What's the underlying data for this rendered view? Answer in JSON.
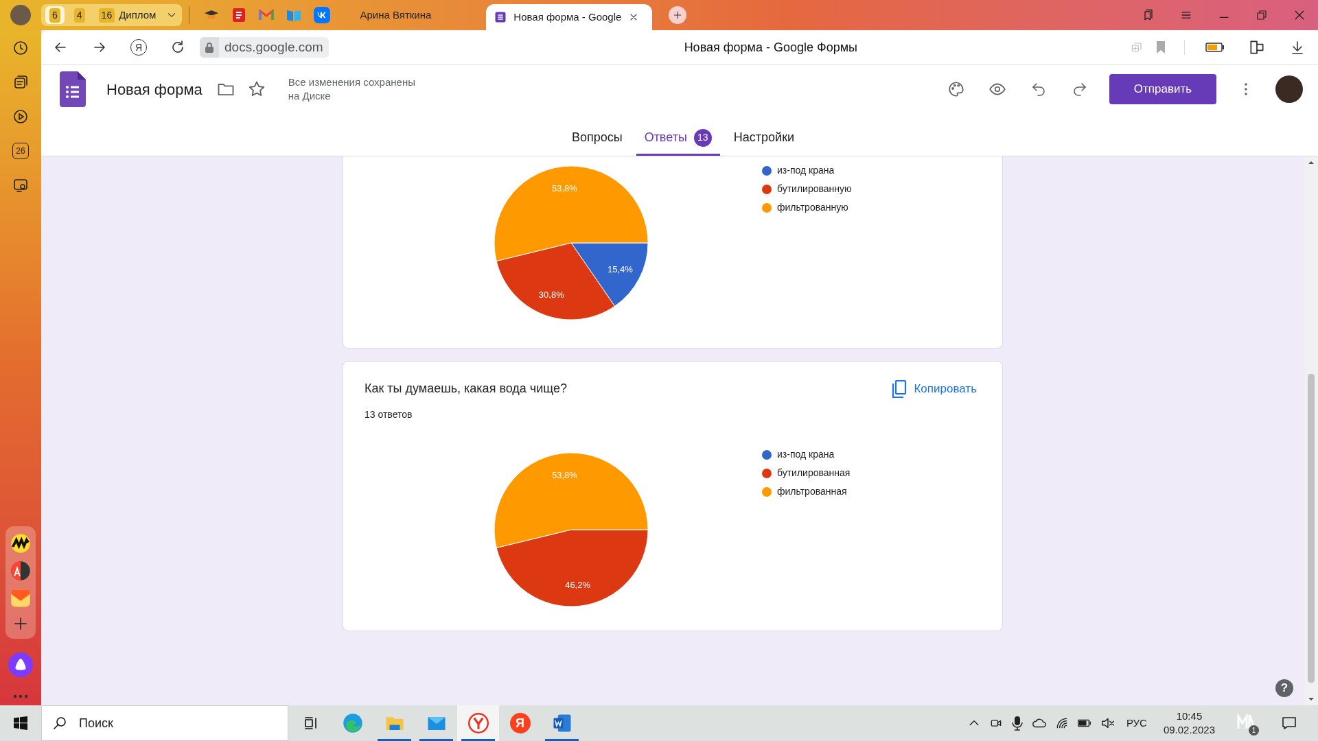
{
  "browser": {
    "tab_groups": [
      {
        "count": "6",
        "selected": true
      },
      {
        "count": "4",
        "selected": false
      },
      {
        "count": "16",
        "label": "Диплом",
        "selected": false
      }
    ],
    "tabs": [
      {
        "title": "Арина Вяткина",
        "selected": false
      },
      {
        "title": "Новая форма - Google",
        "selected": true
      }
    ],
    "address": {
      "yandex_glyph": "Я",
      "url": "docs.google.com",
      "page_title": "Новая форма - Google Формы"
    },
    "sidebar": {
      "calendar_day": "26"
    }
  },
  "form_header": {
    "title": "Новая форма",
    "save_status": "Все изменения сохранены на Диске",
    "send_button": "Отправить",
    "tabs": [
      {
        "label": "Вопросы",
        "selected": false
      },
      {
        "label": "Ответы",
        "badge": "13",
        "selected": true
      },
      {
        "label": "Настройки",
        "selected": false
      }
    ]
  },
  "cards": [
    {
      "chart_data": {
        "type": "pie",
        "categories": [
          "из-под крана",
          "бутилированную",
          "фильтрованную"
        ],
        "values": [
          15.4,
          30.8,
          53.8
        ],
        "value_labels": [
          "15,4%",
          "30,8%",
          "53,8%"
        ]
      },
      "legend": [
        {
          "color": "#3366cc"
        },
        {
          "color": "#dc3912"
        },
        {
          "color": "#ff9900"
        }
      ]
    },
    {
      "title": "Как ты думаешь, какая вода чище?",
      "response_count": "13 ответов",
      "copy_button": "Копировать",
      "chart_data": {
        "type": "pie",
        "categories": [
          "из-под крана",
          "бутилированная",
          "фильтрованная"
        ],
        "values": [
          0,
          46.2,
          53.8
        ],
        "value_labels": [
          null,
          "46,2%",
          "53,8%"
        ]
      },
      "legend": [
        {
          "color": "#3366cc"
        },
        {
          "color": "#dc3912"
        },
        {
          "color": "#ff9900"
        }
      ]
    }
  ],
  "help_glyph": "?",
  "taskbar": {
    "search_placeholder": "Поиск",
    "apps": [
      {
        "kind": "taskview",
        "running": false,
        "selected": false
      },
      {
        "kind": "edge",
        "running": false,
        "selected": false
      },
      {
        "kind": "explorer",
        "running": true,
        "selected": false
      },
      {
        "kind": "mail",
        "running": true,
        "selected": false
      },
      {
        "kind": "browser",
        "running": true,
        "selected": true
      },
      {
        "kind": "yandex",
        "glyph": "Я",
        "running": false,
        "selected": false
      },
      {
        "kind": "word",
        "running": true,
        "selected": false
      }
    ],
    "language": "РУС",
    "time": "10:45",
    "date": "09.02.2023",
    "notification_count": "1"
  }
}
